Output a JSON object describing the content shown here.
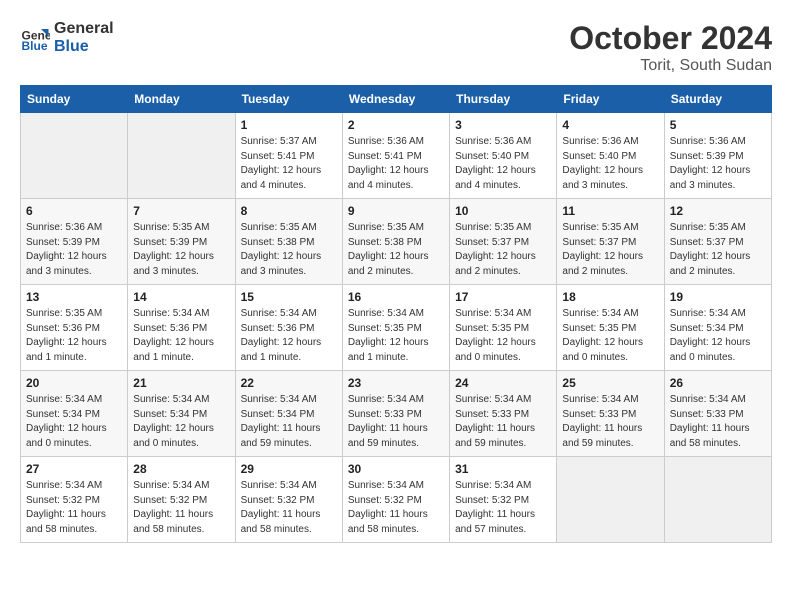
{
  "header": {
    "logo_line1": "General",
    "logo_line2": "Blue",
    "month_year": "October 2024",
    "location": "Torit, South Sudan"
  },
  "weekdays": [
    "Sunday",
    "Monday",
    "Tuesday",
    "Wednesday",
    "Thursday",
    "Friday",
    "Saturday"
  ],
  "weeks": [
    [
      {
        "day": "",
        "sunrise": "",
        "sunset": "",
        "daylight": ""
      },
      {
        "day": "",
        "sunrise": "",
        "sunset": "",
        "daylight": ""
      },
      {
        "day": "1",
        "sunrise": "Sunrise: 5:37 AM",
        "sunset": "Sunset: 5:41 PM",
        "daylight": "Daylight: 12 hours and 4 minutes."
      },
      {
        "day": "2",
        "sunrise": "Sunrise: 5:36 AM",
        "sunset": "Sunset: 5:41 PM",
        "daylight": "Daylight: 12 hours and 4 minutes."
      },
      {
        "day": "3",
        "sunrise": "Sunrise: 5:36 AM",
        "sunset": "Sunset: 5:40 PM",
        "daylight": "Daylight: 12 hours and 4 minutes."
      },
      {
        "day": "4",
        "sunrise": "Sunrise: 5:36 AM",
        "sunset": "Sunset: 5:40 PM",
        "daylight": "Daylight: 12 hours and 3 minutes."
      },
      {
        "day": "5",
        "sunrise": "Sunrise: 5:36 AM",
        "sunset": "Sunset: 5:39 PM",
        "daylight": "Daylight: 12 hours and 3 minutes."
      }
    ],
    [
      {
        "day": "6",
        "sunrise": "Sunrise: 5:36 AM",
        "sunset": "Sunset: 5:39 PM",
        "daylight": "Daylight: 12 hours and 3 minutes."
      },
      {
        "day": "7",
        "sunrise": "Sunrise: 5:35 AM",
        "sunset": "Sunset: 5:39 PM",
        "daylight": "Daylight: 12 hours and 3 minutes."
      },
      {
        "day": "8",
        "sunrise": "Sunrise: 5:35 AM",
        "sunset": "Sunset: 5:38 PM",
        "daylight": "Daylight: 12 hours and 3 minutes."
      },
      {
        "day": "9",
        "sunrise": "Sunrise: 5:35 AM",
        "sunset": "Sunset: 5:38 PM",
        "daylight": "Daylight: 12 hours and 2 minutes."
      },
      {
        "day": "10",
        "sunrise": "Sunrise: 5:35 AM",
        "sunset": "Sunset: 5:37 PM",
        "daylight": "Daylight: 12 hours and 2 minutes."
      },
      {
        "day": "11",
        "sunrise": "Sunrise: 5:35 AM",
        "sunset": "Sunset: 5:37 PM",
        "daylight": "Daylight: 12 hours and 2 minutes."
      },
      {
        "day": "12",
        "sunrise": "Sunrise: 5:35 AM",
        "sunset": "Sunset: 5:37 PM",
        "daylight": "Daylight: 12 hours and 2 minutes."
      }
    ],
    [
      {
        "day": "13",
        "sunrise": "Sunrise: 5:35 AM",
        "sunset": "Sunset: 5:36 PM",
        "daylight": "Daylight: 12 hours and 1 minute."
      },
      {
        "day": "14",
        "sunrise": "Sunrise: 5:34 AM",
        "sunset": "Sunset: 5:36 PM",
        "daylight": "Daylight: 12 hours and 1 minute."
      },
      {
        "day": "15",
        "sunrise": "Sunrise: 5:34 AM",
        "sunset": "Sunset: 5:36 PM",
        "daylight": "Daylight: 12 hours and 1 minute."
      },
      {
        "day": "16",
        "sunrise": "Sunrise: 5:34 AM",
        "sunset": "Sunset: 5:35 PM",
        "daylight": "Daylight: 12 hours and 1 minute."
      },
      {
        "day": "17",
        "sunrise": "Sunrise: 5:34 AM",
        "sunset": "Sunset: 5:35 PM",
        "daylight": "Daylight: 12 hours and 0 minutes."
      },
      {
        "day": "18",
        "sunrise": "Sunrise: 5:34 AM",
        "sunset": "Sunset: 5:35 PM",
        "daylight": "Daylight: 12 hours and 0 minutes."
      },
      {
        "day": "19",
        "sunrise": "Sunrise: 5:34 AM",
        "sunset": "Sunset: 5:34 PM",
        "daylight": "Daylight: 12 hours and 0 minutes."
      }
    ],
    [
      {
        "day": "20",
        "sunrise": "Sunrise: 5:34 AM",
        "sunset": "Sunset: 5:34 PM",
        "daylight": "Daylight: 12 hours and 0 minutes."
      },
      {
        "day": "21",
        "sunrise": "Sunrise: 5:34 AM",
        "sunset": "Sunset: 5:34 PM",
        "daylight": "Daylight: 12 hours and 0 minutes."
      },
      {
        "day": "22",
        "sunrise": "Sunrise: 5:34 AM",
        "sunset": "Sunset: 5:34 PM",
        "daylight": "Daylight: 11 hours and 59 minutes."
      },
      {
        "day": "23",
        "sunrise": "Sunrise: 5:34 AM",
        "sunset": "Sunset: 5:33 PM",
        "daylight": "Daylight: 11 hours and 59 minutes."
      },
      {
        "day": "24",
        "sunrise": "Sunrise: 5:34 AM",
        "sunset": "Sunset: 5:33 PM",
        "daylight": "Daylight: 11 hours and 59 minutes."
      },
      {
        "day": "25",
        "sunrise": "Sunrise: 5:34 AM",
        "sunset": "Sunset: 5:33 PM",
        "daylight": "Daylight: 11 hours and 59 minutes."
      },
      {
        "day": "26",
        "sunrise": "Sunrise: 5:34 AM",
        "sunset": "Sunset: 5:33 PM",
        "daylight": "Daylight: 11 hours and 58 minutes."
      }
    ],
    [
      {
        "day": "27",
        "sunrise": "Sunrise: 5:34 AM",
        "sunset": "Sunset: 5:32 PM",
        "daylight": "Daylight: 11 hours and 58 minutes."
      },
      {
        "day": "28",
        "sunrise": "Sunrise: 5:34 AM",
        "sunset": "Sunset: 5:32 PM",
        "daylight": "Daylight: 11 hours and 58 minutes."
      },
      {
        "day": "29",
        "sunrise": "Sunrise: 5:34 AM",
        "sunset": "Sunset: 5:32 PM",
        "daylight": "Daylight: 11 hours and 58 minutes."
      },
      {
        "day": "30",
        "sunrise": "Sunrise: 5:34 AM",
        "sunset": "Sunset: 5:32 PM",
        "daylight": "Daylight: 11 hours and 58 minutes."
      },
      {
        "day": "31",
        "sunrise": "Sunrise: 5:34 AM",
        "sunset": "Sunset: 5:32 PM",
        "daylight": "Daylight: 11 hours and 57 minutes."
      },
      {
        "day": "",
        "sunrise": "",
        "sunset": "",
        "daylight": ""
      },
      {
        "day": "",
        "sunrise": "",
        "sunset": "",
        "daylight": ""
      }
    ]
  ]
}
